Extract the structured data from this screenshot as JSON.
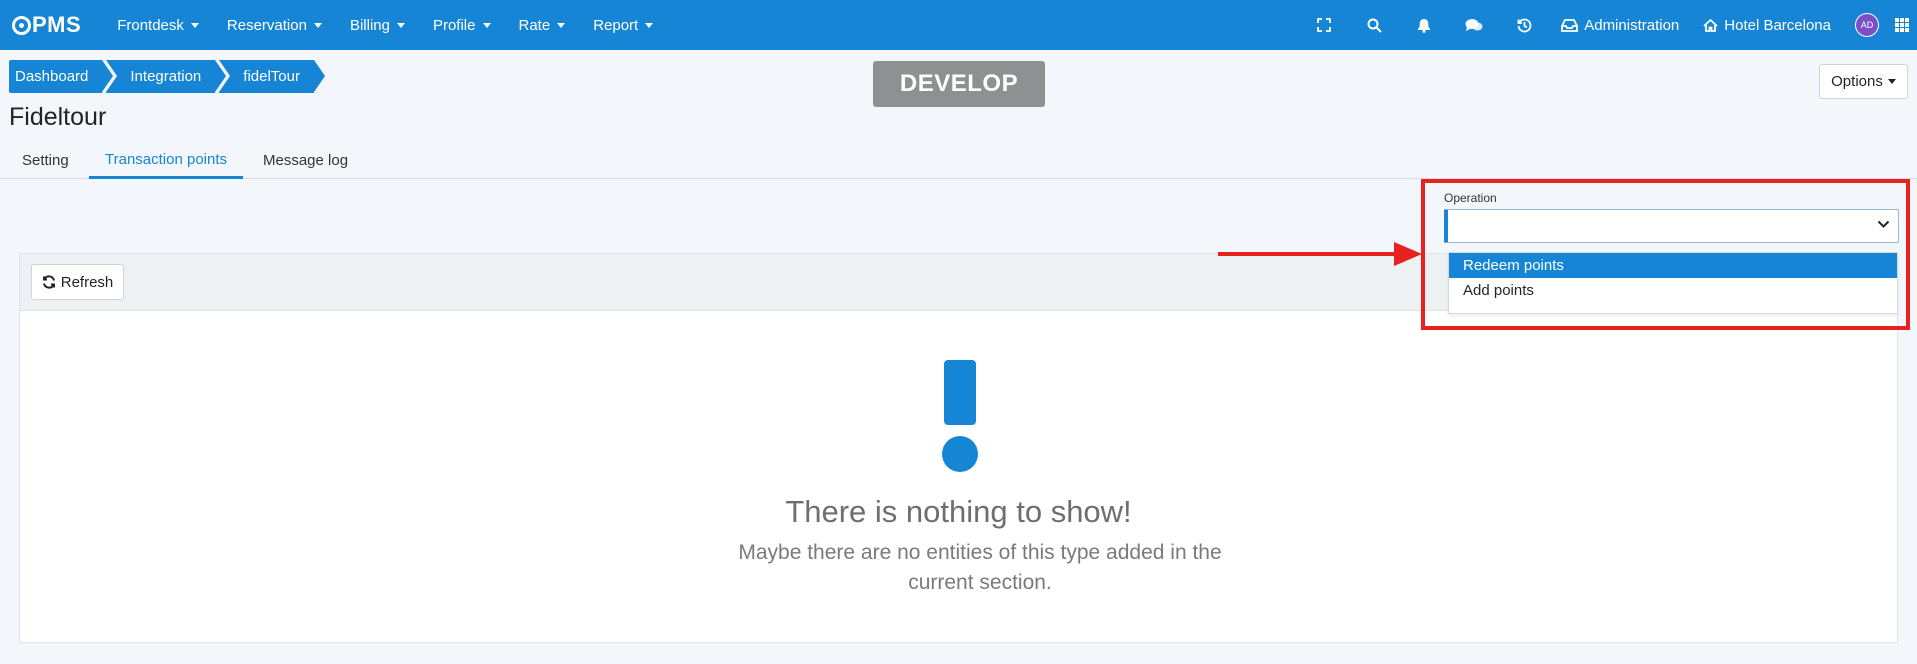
{
  "navbar": {
    "brand": "PMS",
    "menu": [
      {
        "label": "Frontdesk"
      },
      {
        "label": "Reservation"
      },
      {
        "label": "Billing"
      },
      {
        "label": "Profile"
      },
      {
        "label": "Rate"
      },
      {
        "label": "Report"
      }
    ],
    "administration": "Administration",
    "hotel": "Hotel Barcelona",
    "avatar_initials": "AD"
  },
  "breadcrumb": [
    "Dashboard",
    "Integration",
    "fidelTour"
  ],
  "environment_badge": "DEVELOP",
  "options_label": "Options",
  "page_title": "Fideltour",
  "tabs": [
    {
      "label": "Setting",
      "active": false
    },
    {
      "label": "Transaction points",
      "active": true
    },
    {
      "label": "Message log",
      "active": false
    }
  ],
  "operation": {
    "label": "Operation",
    "value": "",
    "options": [
      {
        "label": "Redeem points",
        "highlighted": true
      },
      {
        "label": "Add points",
        "highlighted": false
      }
    ]
  },
  "toolbar": {
    "refresh_label": "Refresh"
  },
  "empty_state": {
    "title": "There is nothing to show!",
    "subtitle": "Maybe there are no entities of this type added in the current section."
  },
  "colors": {
    "primary": "#1685d6",
    "annotation": "#e8221f",
    "badge": "#8e9092"
  }
}
